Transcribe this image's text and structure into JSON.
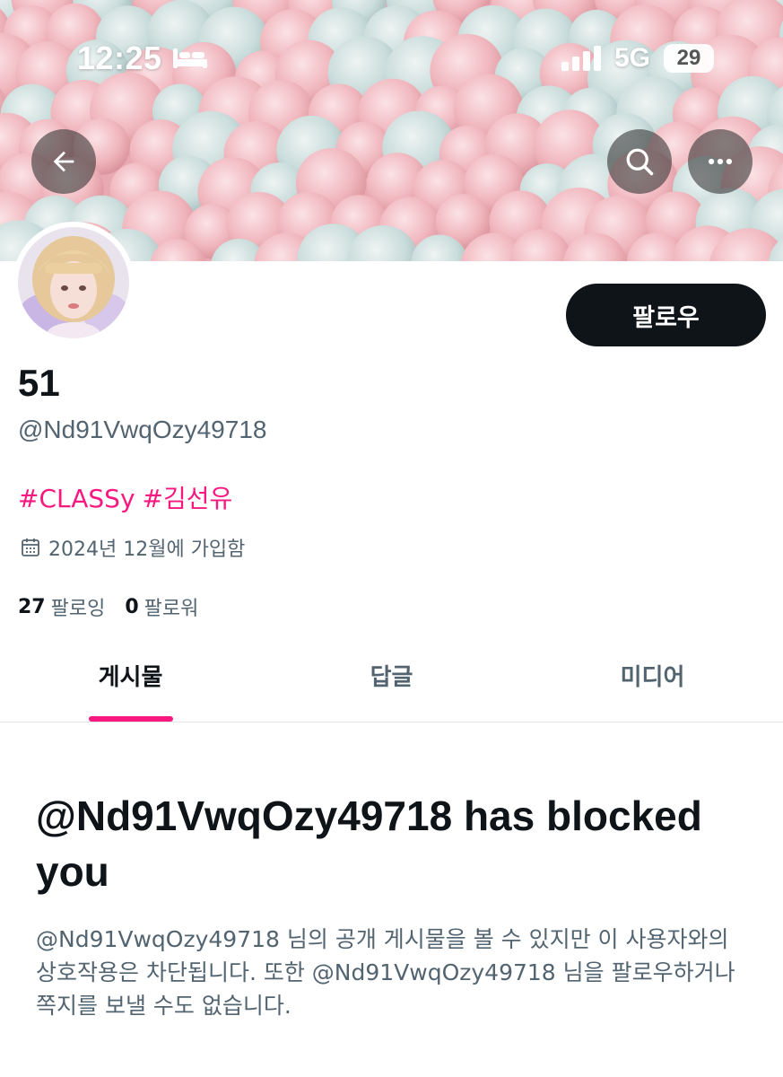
{
  "status_bar": {
    "time": "12:25",
    "network": "5G",
    "battery": "29"
  },
  "header_buttons": {
    "back_icon": "arrow-left-icon",
    "search_icon": "search-icon",
    "more_icon": "more-horizontal-icon"
  },
  "profile": {
    "display_name": "51",
    "handle": "@Nd91VwqOzy49718",
    "follow_label": "팔로우",
    "bio_tags": [
      "#CLASSy",
      "#김선유"
    ],
    "joined": "2024년 12월에 가입함",
    "following_count": "27",
    "following_label": "팔로잉",
    "followers_count": "0",
    "followers_label": "팔로워"
  },
  "tabs": [
    {
      "label": "게시물",
      "active": true
    },
    {
      "label": "답글",
      "active": false
    },
    {
      "label": "미디어",
      "active": false
    }
  ],
  "blocked": {
    "title": "@Nd91VwqOzy49718 has blocked you",
    "description": "@Nd91VwqOzy49718 님의 공개 게시물을 볼 수 있지만 이 사용자와의 상호작용은 차단됩니다. 또한 @Nd91VwqOzy49718 님을 팔로우하거나 쪽지를 보낼 수도 없습니다."
  },
  "colors": {
    "accent": "#f91880",
    "text_primary": "#0f1419",
    "text_secondary": "#536471",
    "button_dark": "#0f1419"
  }
}
